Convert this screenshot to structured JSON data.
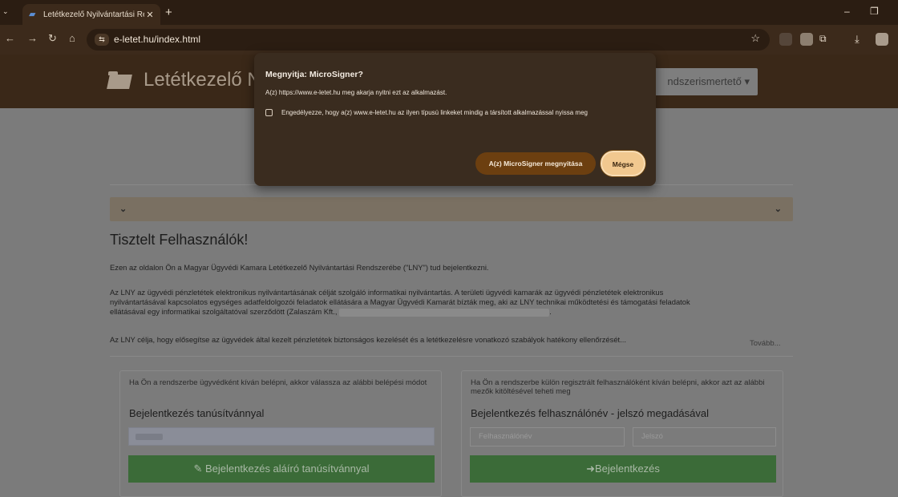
{
  "browser": {
    "tab_title": "Letétkezelő Nyilvántartási Rend",
    "tab_close": "✕",
    "new_tab": "+",
    "url": "e-letet.hu/index.html",
    "icons": [
      "back-icon",
      "forward-icon",
      "reload-icon",
      "home-icon",
      "site-info-icon",
      "bookmark-star-icon",
      "download-icon"
    ]
  },
  "header": {
    "brand": "Letétkezelő N",
    "menu_button": "ndszerismertető ▾"
  },
  "main": {
    "greeting": "Tisztelt Felhasználók!",
    "intro": "Ezen az oldalon Ön a Magyar Ügyvédi Kamara Letétkezelő Nyilvántartási Rendszerébe (\"LNY\") tud bejelentkezni.",
    "para2_l1": "Az LNY az ügyvédi pénzletétek elektronikus nyilvántartásának célját szolgáló informatikai nyilvántartás. A területi ügyvédi kamarák az ügyvédi pénzletétek elektronikus",
    "para2_l2": "nyilvántartásával kapcsolatos egységes adatfeldolgozói feladatok ellátására a Magyar Ügyvédi Kamarát bízták meg, aki az LNY technikai működtetési és támogatási feladatok",
    "para2_l3": "ellátásával egy informatikai szolgáltatóval szerződött (Zalaszám Kft.,",
    "para2_l3_end": ".",
    "para3": "Az LNY célja, hogy elősegítse az ügyvédek által kezelt pénzletétek biztonságos kezelését és a letétkezelésre vonatkozó szabályok hatékony ellenőrzését...",
    "more_link": "Tovább..."
  },
  "cert_panel": {
    "hint": "Ha Ön a rendszerbe ügyvédként kíván belépni, akkor válassza az alábbi belépési módot",
    "title": "Bejelentkezés tanúsítvánnyal",
    "button": "Bejelentkezés aláíró tanúsítvánnyal"
  },
  "user_panel": {
    "hint": "Ha Ön a rendszerbe külön regisztrált felhasználóként kíván belépni, akkor azt az alábbi mezők kitöltésével teheti meg",
    "title": "Bejelentkezés felhasználónév - jelszó megadásával",
    "username_placeholder": "Felhasználónév",
    "password_placeholder": "Jelszó",
    "button": "Bejelentkezés"
  },
  "dialog": {
    "title": "Megnyitja: MicroSigner?",
    "message": "A(z) https://www.e-letet.hu meg akarja nyitni ezt az alkalmazást.",
    "checkbox_label": "Engedélyezze, hogy a(z) www.e-letet.hu az ilyen típusú linkeket mindig a társított alkalmazással nyissa meg",
    "open_button": "A(z) MicroSigner megnyitása",
    "cancel_button": "Mégse"
  }
}
